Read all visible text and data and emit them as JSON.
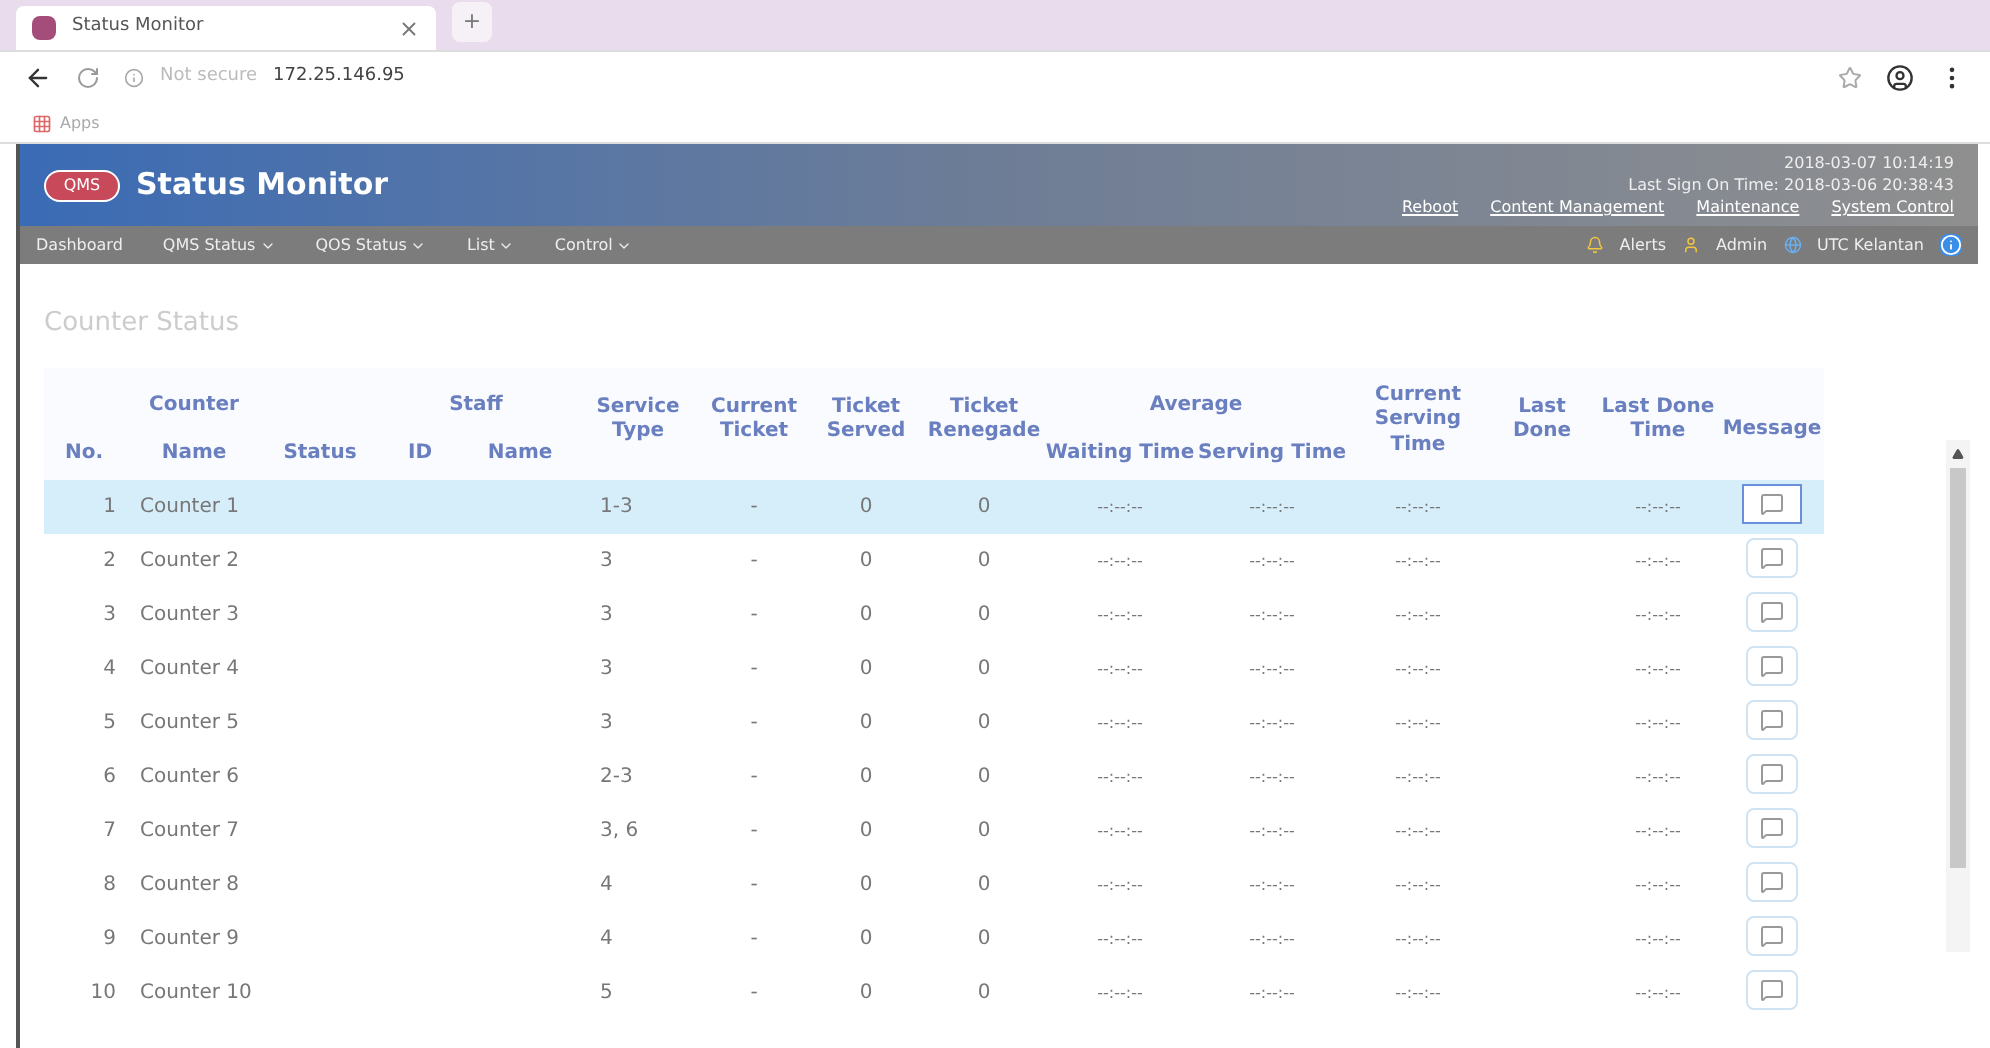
{
  "browser": {
    "tab_title": "Status Monitor",
    "new_tab": "+",
    "security": "Not secure",
    "address": "172.25.146.95",
    "bookmark": "Apps"
  },
  "header": {
    "logo": "QMS",
    "title": "Status Monitor",
    "datetime": "2018-03-07 10:14:19",
    "last_sign_on": "Last Sign On Time: 2018-03-06 20:38:43",
    "links": [
      "Reboot",
      "Content Management",
      "Maintenance",
      "System Control"
    ]
  },
  "nav": {
    "items": [
      {
        "label": "Dashboard",
        "dropdown": false
      },
      {
        "label": "QMS Status",
        "dropdown": true
      },
      {
        "label": "QOS Status",
        "dropdown": true
      },
      {
        "label": "List",
        "dropdown": true
      },
      {
        "label": "Control",
        "dropdown": true
      }
    ],
    "alerts": "Alerts",
    "user": "Admin",
    "site": "UTC Kelantan"
  },
  "section_title": "Counter Status",
  "table": {
    "groups": {
      "counter": "Counter",
      "staff": "Staff",
      "average": "Average"
    },
    "columns": [
      "No.",
      "Name",
      "Status",
      "ID",
      "Name",
      "Service Type",
      "Current Ticket",
      "Ticket Served",
      "Ticket Renegade",
      "Waiting Time",
      "Serving Time",
      "Current Serving Time",
      "Last Done",
      "Last Done Time",
      "Message"
    ],
    "rows": [
      {
        "no": "1",
        "name": "Counter 1",
        "service_type": "1-3",
        "current_ticket": "-",
        "served": "0",
        "renegade": "0",
        "waiting": "--:--:--",
        "serving": "--:--:--",
        "current_serving": "--:--:--",
        "last_done_time": "--:--:--",
        "selected": true
      },
      {
        "no": "2",
        "name": "Counter 2",
        "service_type": "3",
        "current_ticket": "-",
        "served": "0",
        "renegade": "0",
        "waiting": "--:--:--",
        "serving": "--:--:--",
        "current_serving": "--:--:--",
        "last_done_time": "--:--:--",
        "selected": false
      },
      {
        "no": "3",
        "name": "Counter 3",
        "service_type": "3",
        "current_ticket": "-",
        "served": "0",
        "renegade": "0",
        "waiting": "--:--:--",
        "serving": "--:--:--",
        "current_serving": "--:--:--",
        "last_done_time": "--:--:--",
        "selected": false
      },
      {
        "no": "4",
        "name": "Counter 4",
        "service_type": "3",
        "current_ticket": "-",
        "served": "0",
        "renegade": "0",
        "waiting": "--:--:--",
        "serving": "--:--:--",
        "current_serving": "--:--:--",
        "last_done_time": "--:--:--",
        "selected": false
      },
      {
        "no": "5",
        "name": "Counter 5",
        "service_type": "3",
        "current_ticket": "-",
        "served": "0",
        "renegade": "0",
        "waiting": "--:--:--",
        "serving": "--:--:--",
        "current_serving": "--:--:--",
        "last_done_time": "--:--:--",
        "selected": false
      },
      {
        "no": "6",
        "name": "Counter 6",
        "service_type": "2-3",
        "current_ticket": "-",
        "served": "0",
        "renegade": "0",
        "waiting": "--:--:--",
        "serving": "--:--:--",
        "current_serving": "--:--:--",
        "last_done_time": "--:--:--",
        "selected": false
      },
      {
        "no": "7",
        "name": "Counter 7",
        "service_type": "3, 6",
        "current_ticket": "-",
        "served": "0",
        "renegade": "0",
        "waiting": "--:--:--",
        "serving": "--:--:--",
        "current_serving": "--:--:--",
        "last_done_time": "--:--:--",
        "selected": false
      },
      {
        "no": "8",
        "name": "Counter 8",
        "service_type": "4",
        "current_ticket": "-",
        "served": "0",
        "renegade": "0",
        "waiting": "--:--:--",
        "serving": "--:--:--",
        "current_serving": "--:--:--",
        "last_done_time": "--:--:--",
        "selected": false
      },
      {
        "no": "9",
        "name": "Counter 9",
        "service_type": "4",
        "current_ticket": "-",
        "served": "0",
        "renegade": "0",
        "waiting": "--:--:--",
        "serving": "--:--:--",
        "current_serving": "--:--:--",
        "last_done_time": "--:--:--",
        "selected": false
      },
      {
        "no": "10",
        "name": "Counter 10",
        "service_type": "5",
        "current_ticket": "-",
        "served": "0",
        "renegade": "0",
        "waiting": "--:--:--",
        "serving": "--:--:--",
        "current_serving": "--:--:--",
        "last_done_time": "--:--:--",
        "selected": false
      }
    ]
  }
}
